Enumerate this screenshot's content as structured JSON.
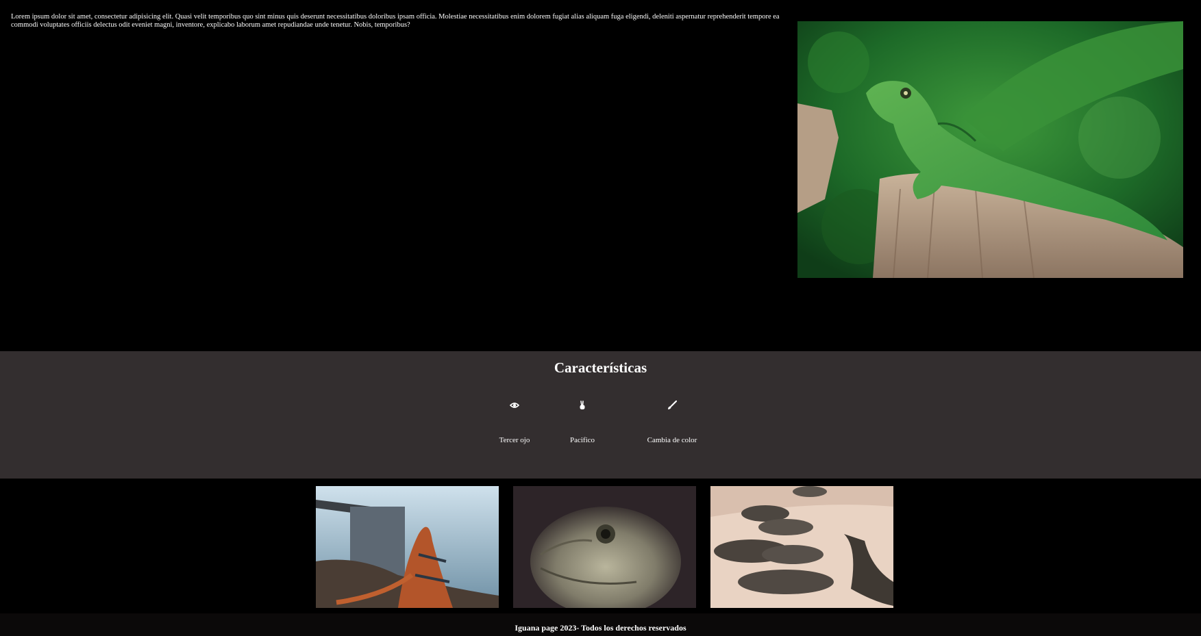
{
  "hero": {
    "text": "Lorem ipsum dolor sit amet, consectetur adipisicing elit. Quasi velit temporibus quo sint minus quis deserunt necessitatibus doloribus ipsam officia. Molestiae necessitatibus enim dolorem fugiat alias aliquam fuga eligendi, deleniti aspernatur reprehenderit tempore ea commodi voluptates officiis delectus odit eveniet magni, inventore, explicabo laborum amet repudiandae unde tenetur. Nobis, temporibus?",
    "image_icon": "green-iguana-photo"
  },
  "features": {
    "title": "Características",
    "items": [
      {
        "label": "Tercer ojo",
        "icon": "eye-icon"
      },
      {
        "label": "Pacifico",
        "icon": "peace-hand-icon"
      },
      {
        "label": "Cambia de color",
        "icon": "paintbrush-icon"
      }
    ]
  },
  "gallery": {
    "images": [
      "iguana-on-rocks-photo",
      "iguana-face-photo",
      "iguanas-on-beach-photo"
    ]
  },
  "footer": {
    "text": "Iguana page 2023- Todos los derechos reservados"
  },
  "colors": {
    "background": "#000000",
    "features_bg": "#332e2f",
    "text": "#ffffff"
  }
}
